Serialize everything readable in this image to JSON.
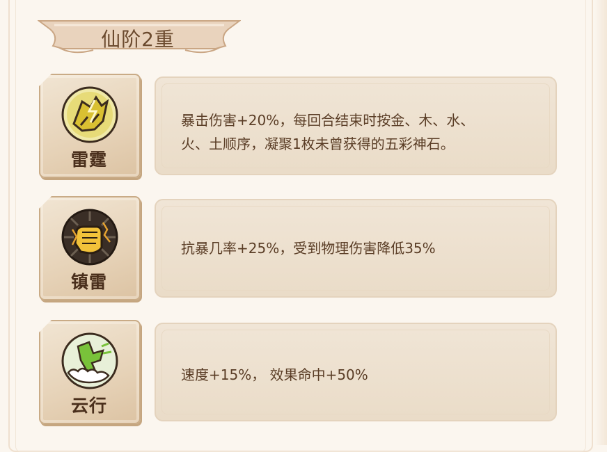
{
  "header": {
    "title": "仙阶2重"
  },
  "skills": [
    {
      "name": "雷霆",
      "icon": "lightning-fist-icon",
      "description_lines": [
        "暴击伤害+20%，每回合结束时按金、木、水、",
        "火、土顺序，凝聚1枚未曾获得的五彩神石。"
      ]
    },
    {
      "name": "镇雷",
      "icon": "golden-fist-icon",
      "description_lines": [
        "抗暴几率+25%，受到物理伤害降低35%"
      ]
    },
    {
      "name": "云行",
      "icon": "cloud-walk-icon",
      "description_lines": [
        "速度+15%， 效果命中+50%"
      ]
    }
  ],
  "colors": {
    "background": "#fbf6ef",
    "text_brown": "#5a3d26",
    "label_dark": "#4a2f1c",
    "panel": "#eadcc8"
  }
}
